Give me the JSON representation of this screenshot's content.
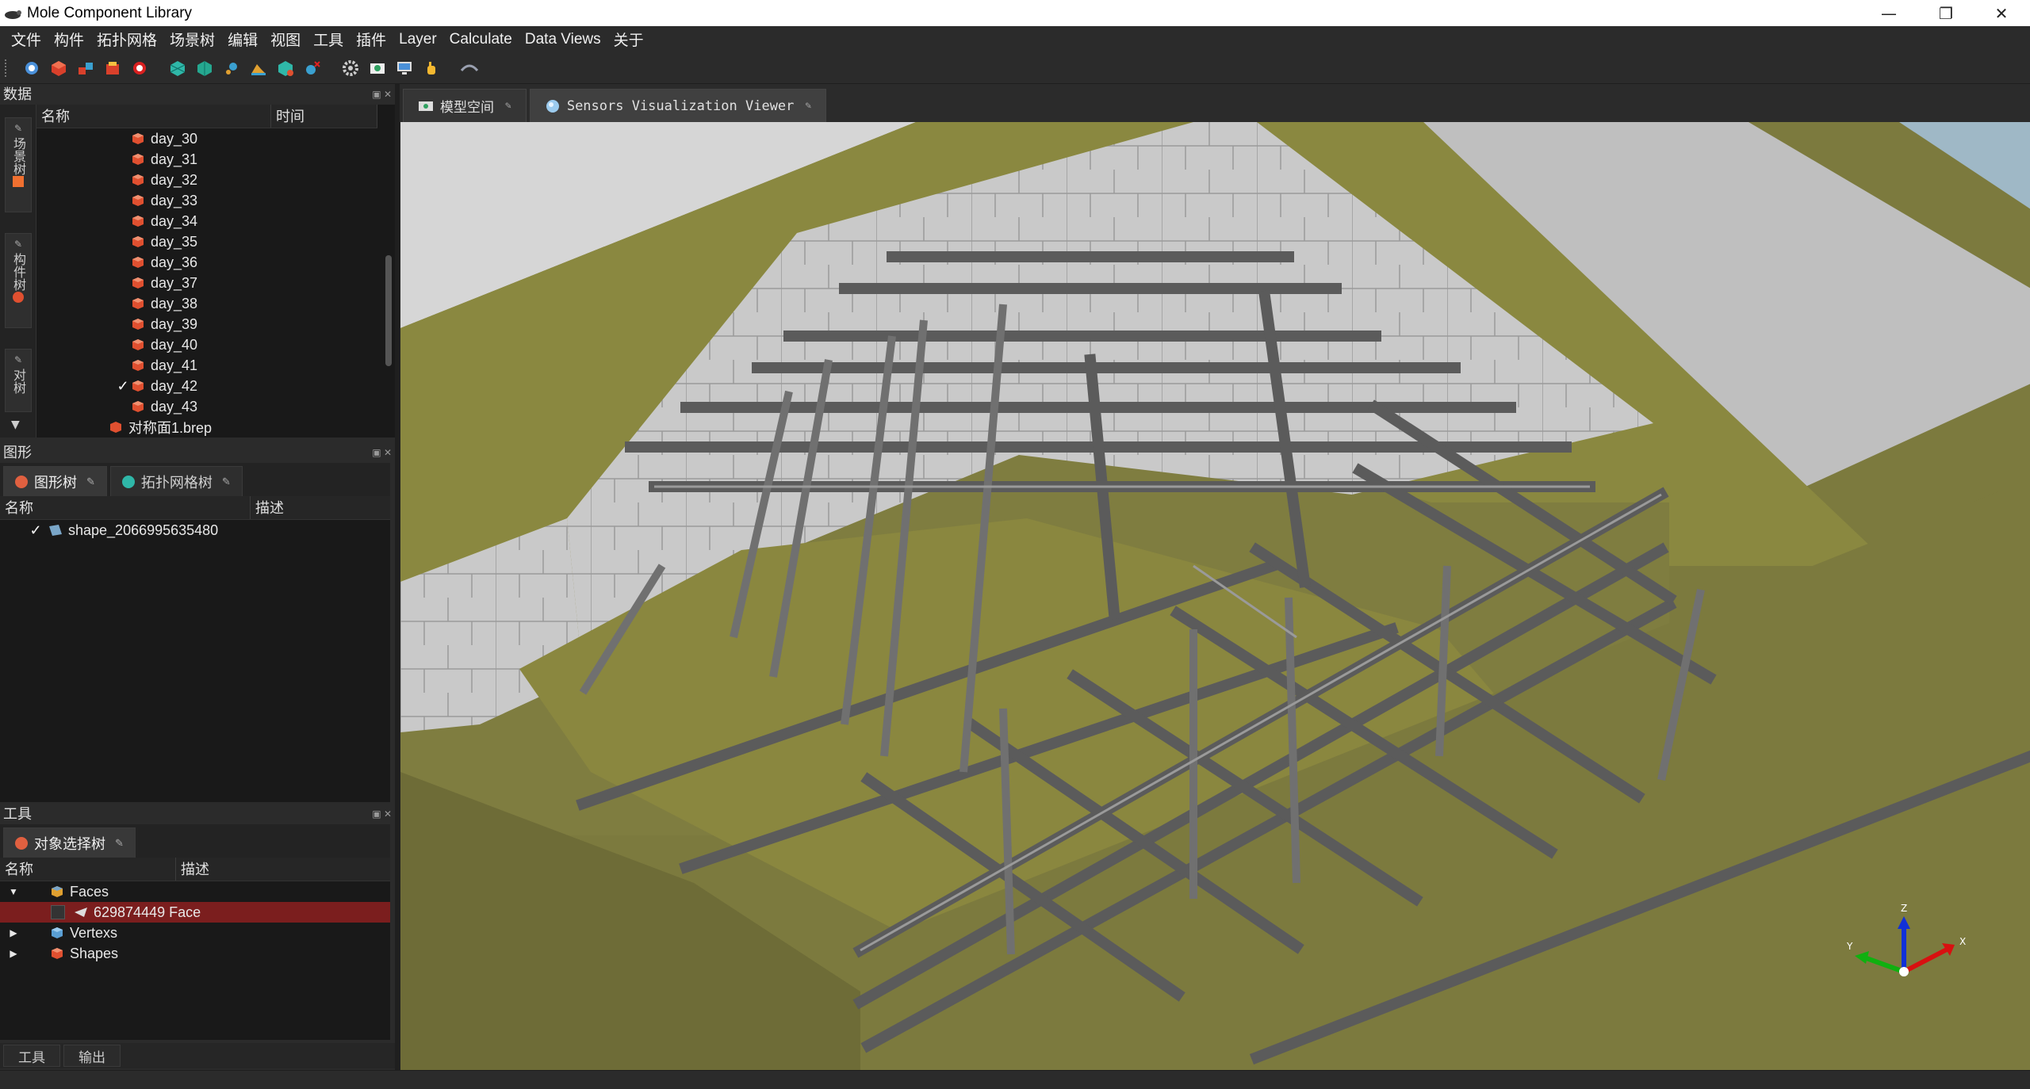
{
  "window": {
    "title": "Mole Component Library"
  },
  "menu": [
    "文件",
    "构件",
    "拓扑网格",
    "场景树",
    "编辑",
    "视图",
    "工具",
    "插件",
    "Layer",
    "Calculate",
    "Data Views",
    "关于"
  ],
  "toolbar": {
    "icons": [
      "refresh-icon",
      "cube-red-icon",
      "cubes-icon",
      "cube-stack-icon",
      "stop-icon",
      "mesh-icon",
      "mesh-2-icon",
      "node-icon",
      "terrain-icon",
      "mesh-edit-icon",
      "mesh-delete-icon",
      "settings-icon",
      "image-icon",
      "monitor-icon",
      "hand-icon",
      "link-icon"
    ]
  },
  "data_panel": {
    "title": "数据",
    "vtabs": [
      "场景树",
      "构件树",
      "对树"
    ],
    "columns": [
      "名称",
      "时间"
    ],
    "rows": [
      {
        "label": "day_30",
        "checked": false
      },
      {
        "label": "day_31",
        "checked": false
      },
      {
        "label": "day_32",
        "checked": false
      },
      {
        "label": "day_33",
        "checked": false
      },
      {
        "label": "day_34",
        "checked": false
      },
      {
        "label": "day_35",
        "checked": false
      },
      {
        "label": "day_36",
        "checked": false
      },
      {
        "label": "day_37",
        "checked": false
      },
      {
        "label": "day_38",
        "checked": false
      },
      {
        "label": "day_39",
        "checked": false
      },
      {
        "label": "day_40",
        "checked": false
      },
      {
        "label": "day_41",
        "checked": false
      },
      {
        "label": "day_42",
        "checked": true
      },
      {
        "label": "day_43",
        "checked": false
      }
    ],
    "file_row": "对称面1.brep"
  },
  "shape_panel": {
    "title": "图形",
    "tabs": [
      "图形树",
      "拓扑网格树"
    ],
    "columns": [
      "名称",
      "描述"
    ],
    "rows": [
      {
        "label": "shape_2066995635480",
        "checked": true
      }
    ]
  },
  "tool_panel": {
    "title": "工具",
    "tabs": [
      "对象选择树"
    ],
    "columns": [
      "名称",
      "描述"
    ],
    "rows": [
      {
        "label": "Faces",
        "expanded": true,
        "icon_color": "#e0a030"
      },
      {
        "label": "629874449 Face",
        "selected": true
      },
      {
        "label": "Vertexs",
        "expanded": false,
        "icon_color": "#5a9fd4"
      },
      {
        "label": "Shapes",
        "expanded": false,
        "icon_color": "#e05030"
      }
    ]
  },
  "bottom_tabs": [
    "工具",
    "输出"
  ],
  "viewer": {
    "tabs": [
      "模型空间",
      "Sensors Visualization Viewer"
    ],
    "active_tab": 1,
    "axis_labels": {
      "x": "X",
      "y": "Y",
      "z": "Z"
    }
  },
  "colors": {
    "ground": "#7c7a3e",
    "steel": "#6b6b6b",
    "selected_row": "#7b1e1e",
    "accent_red": "#d9402b"
  }
}
